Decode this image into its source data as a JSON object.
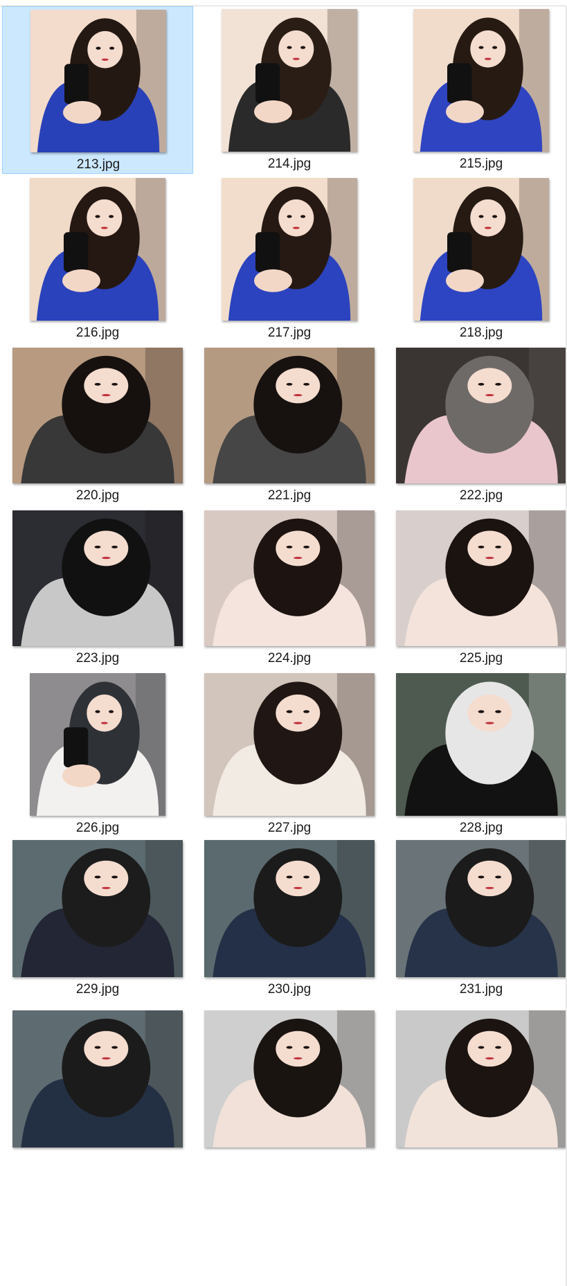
{
  "files": [
    {
      "name": "213.jpg",
      "kind": "portrait",
      "palette": [
        "#f3dccb",
        "#2941b8",
        "#241812"
      ],
      "selected": true
    },
    {
      "name": "214.jpg",
      "kind": "portrait",
      "palette": [
        "#f2e2d5",
        "#2a2a2a",
        "#2a1d15"
      ],
      "selected": false
    },
    {
      "name": "215.jpg",
      "kind": "portrait",
      "palette": [
        "#f1dccc",
        "#2e44c0",
        "#271a12"
      ],
      "selected": false
    },
    {
      "name": "216.jpg",
      "kind": "portrait",
      "palette": [
        "#f0dac8",
        "#2a42bc",
        "#251812"
      ],
      "selected": false
    },
    {
      "name": "217.jpg",
      "kind": "portrait",
      "palette": [
        "#f2ddcc",
        "#2b43be",
        "#261913"
      ],
      "selected": false
    },
    {
      "name": "218.jpg",
      "kind": "portrait",
      "palette": [
        "#f0dbca",
        "#2d45c2",
        "#261a13"
      ],
      "selected": false
    },
    {
      "name": "220.jpg",
      "kind": "landscape",
      "palette": [
        "#b79a80",
        "#383838",
        "#16110f"
      ],
      "selected": false
    },
    {
      "name": "221.jpg",
      "kind": "landscape",
      "palette": [
        "#b59a82",
        "#464646",
        "#17120f"
      ],
      "selected": false
    },
    {
      "name": "222.jpg",
      "kind": "landscape",
      "palette": [
        "#3a3532",
        "#e9c6cc",
        "#6e6a67"
      ],
      "selected": false
    },
    {
      "name": "223.jpg",
      "kind": "landscape",
      "palette": [
        "#2c2d33",
        "#c8c8c8",
        "#111111"
      ],
      "selected": false
    },
    {
      "name": "224.jpg",
      "kind": "landscape",
      "palette": [
        "#d9c9c3",
        "#f5e4dd",
        "#1d1411"
      ],
      "selected": false
    },
    {
      "name": "225.jpg",
      "kind": "landscape",
      "palette": [
        "#d8cfcc",
        "#f3e3da",
        "#1b1310"
      ],
      "selected": false
    },
    {
      "name": "226.jpg",
      "kind": "portrait",
      "palette": [
        "#8e8c8f",
        "#f3f1ef",
        "#2e3237"
      ],
      "selected": false
    },
    {
      "name": "227.jpg",
      "kind": "landscape",
      "palette": [
        "#d2c5bb",
        "#f1ebe4",
        "#201714"
      ],
      "selected": false
    },
    {
      "name": "228.jpg",
      "kind": "landscape",
      "palette": [
        "#4e5a4f",
        "#121212",
        "#e6e6e6"
      ],
      "selected": false
    },
    {
      "name": "229.jpg",
      "kind": "landscape",
      "palette": [
        "#5b6b70",
        "#232635",
        "#1c1c1c"
      ],
      "selected": false
    },
    {
      "name": "230.jpg",
      "kind": "landscape",
      "palette": [
        "#5a6a6e",
        "#243047",
        "#1b1b1b"
      ],
      "selected": false
    },
    {
      "name": "231.jpg",
      "kind": "landscape",
      "palette": [
        "#6a7478",
        "#263349",
        "#1b1b1b"
      ],
      "selected": false
    },
    {
      "name": "",
      "kind": "landscape",
      "palette": [
        "#5e6b70",
        "#233044",
        "#1b1b1b"
      ],
      "selected": false
    },
    {
      "name": "",
      "kind": "landscape",
      "palette": [
        "#cfcfcf",
        "#f1e1d8",
        "#1a1411"
      ],
      "selected": false
    },
    {
      "name": "",
      "kind": "landscape",
      "palette": [
        "#c9c9c9",
        "#f2e3da",
        "#1b1411"
      ],
      "selected": false
    }
  ]
}
